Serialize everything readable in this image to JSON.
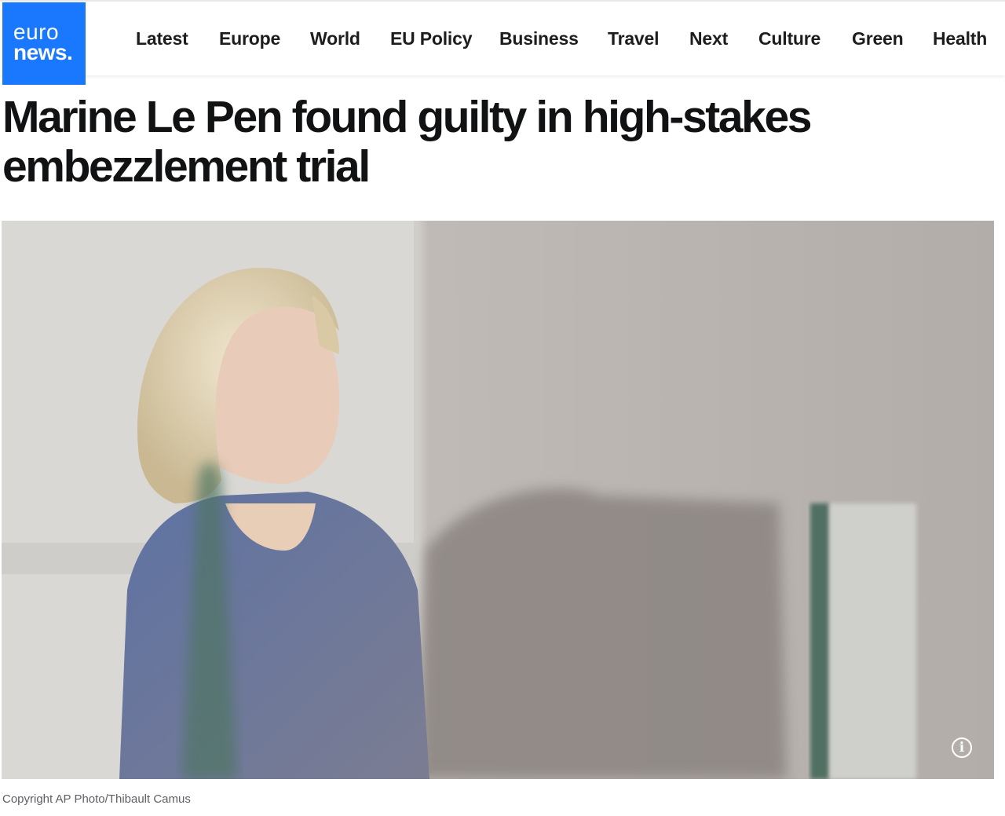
{
  "brand": {
    "line1": "euro",
    "line2": "news.",
    "color": "#1a78ff"
  },
  "nav": {
    "items": [
      "Latest",
      "Europe",
      "World",
      "EU Policy",
      "Business",
      "Travel",
      "Next",
      "Culture",
      "Green",
      "Health"
    ]
  },
  "article": {
    "title": "Marine Le Pen found guilty in high-stakes embezzlement trial",
    "image": {
      "info_icon": "info-icon",
      "caption": "Copyright AP Photo/Thibault Camus"
    }
  }
}
